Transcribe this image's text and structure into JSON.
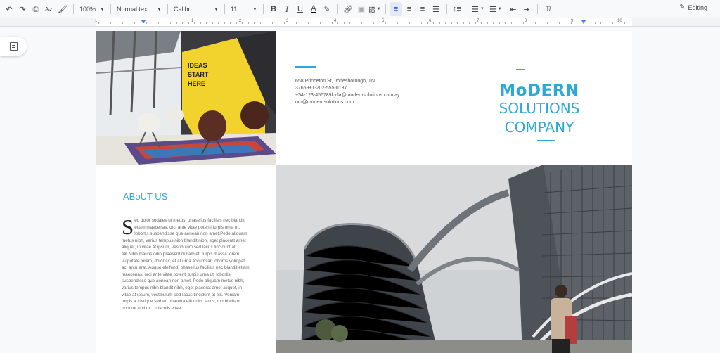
{
  "toolbar": {
    "zoom": "100%",
    "style": "Normal text",
    "font": "Calibri",
    "font_size": "11",
    "mode": "Editing",
    "icons": [
      "undo-icon",
      "redo-icon",
      "print-icon",
      "spellcheck-icon",
      "paint-format-icon",
      "bold-icon",
      "italic-icon",
      "underline-icon",
      "text-color-icon",
      "highlight-icon",
      "link-icon",
      "comment-icon",
      "image-icon",
      "align-left-icon",
      "align-center-icon",
      "align-right-icon",
      "justify-icon",
      "line-spacing-icon",
      "numbered-list-icon",
      "bulleted-list-icon",
      "decrease-indent-icon",
      "increase-indent-icon",
      "clear-formatting-icon"
    ]
  },
  "ruler": {
    "numbers": [
      "1",
      "1",
      "2",
      "3",
      "4",
      "5",
      "6",
      "7",
      "8",
      "9",
      "10"
    ]
  },
  "document": {
    "address_lines": [
      "658 Princeton St, Jonesborough, TN",
      "37659+1-202-555-0137 |",
      "+54-123-456789kylla@modernsolutions.com.ay",
      "om@modernsolutions.com"
    ],
    "logo_line1": "MoDERN",
    "logo_line2": "SOLUTIONS",
    "logo_line3": "COMPANY",
    "about_title": "ABoUT US",
    "dropcap": "S",
    "body": "ed dolor sodales ut metus, phasellus facilisis nec blandit etiam maecenas, orci ante vitae potenti turpis urna ut, lobortis suspendisse que aenean non amet.Pede aliquam metus nibh, varius tempus nibh blandit nibh, eget placerat amet aliquet, in vitae at ipsum, vestibulum sed lacus tincidunt at elit.Nibh mauris odio praesent nullam et, turpis massa lorem vulputate lorem, dolor sit, et at urna accumsan lobortis volutpat ac, arcu erat. Augue eleifend, phasellus facilisis nec blandit etiam maecenas, orci ante vitae potenti turpis urna ut, lobortis suspendisse que aenean non amet. Pede aliquam metus nibh, varius tempus nibh blandit nibh, eget placerat amet aliquet, in vitae at ipsum, vestibulum sed lacus tincidunt at elit. Veniam turpis a tristique sed et, pharetra elit dolor lacus, morbi etiam porttitor orci ut. Ut iaculis vitae"
  },
  "colors": {
    "accent": "#2ea8d8",
    "toolbar_bg": "#f8f9fa",
    "active_button": "#e3e9f7"
  }
}
